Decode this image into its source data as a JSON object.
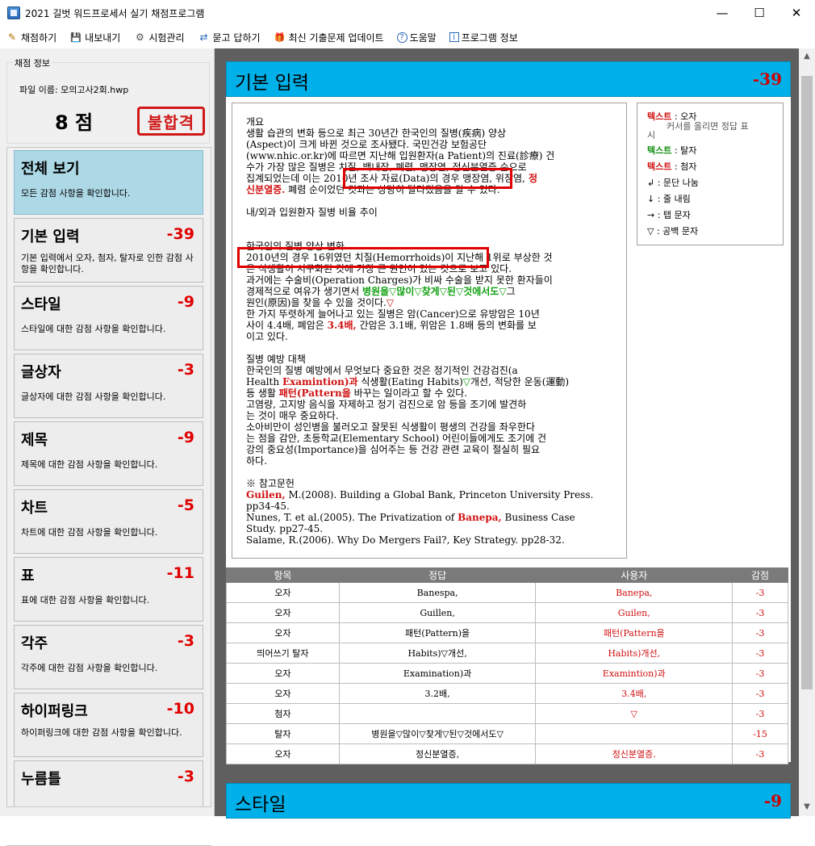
{
  "window": {
    "title": "2021 길벗 워드프로세서 실기 채점프로그램",
    "minimize": "—",
    "maximize": "☐",
    "close": "✕"
  },
  "menu": [
    {
      "icon": "pencil-icon",
      "glyph": "✎",
      "label": "채점하기"
    },
    {
      "icon": "save-icon",
      "glyph": "💾",
      "label": "내보내기"
    },
    {
      "icon": "gear-icon",
      "glyph": "⚙",
      "label": "시험관리"
    },
    {
      "icon": "qa-icon",
      "glyph": "⇄",
      "label": "묻고 답하기"
    },
    {
      "icon": "gift-icon",
      "glyph": "🎁",
      "label": "최신 기출문제 업데이트"
    },
    {
      "icon": "help-icon",
      "glyph": "?",
      "label": "도움말"
    },
    {
      "icon": "info-icon",
      "glyph": "i",
      "label": "프로그램 정보"
    }
  ],
  "score_info": {
    "legend": "채점 정보",
    "file_name": "파일 이름: 모의고사2회.hwp",
    "score": "8 점",
    "result_stamp": "불합격"
  },
  "categories": [
    {
      "title": "전체 보기",
      "score": "",
      "desc": "모든 감점 사항을 확인합니다."
    },
    {
      "title": "기본 입력",
      "score": "-39",
      "desc": "기본 입력에서 오자, 첨자, 탈자로 인한 감점 사항을 확인합니다."
    },
    {
      "title": "스타일",
      "score": "-9",
      "desc": "스타일에 대한 감점 사항을 확인합니다."
    },
    {
      "title": "글상자",
      "score": "-3",
      "desc": "글상자에 대한 감점 사항을 확인합니다."
    },
    {
      "title": "제목",
      "score": "-9",
      "desc": "제목에 대한 감점 사항을 확인합니다."
    },
    {
      "title": "차트",
      "score": "-5",
      "desc": "차트에 대한 감점 사항을 확인합니다."
    },
    {
      "title": "표",
      "score": "-11",
      "desc": "표에 대한 감점 사항을 확인합니다."
    },
    {
      "title": "각주",
      "score": "-3",
      "desc": "각주에 대한 감점 사항을 확인합니다."
    },
    {
      "title": "하이퍼링크",
      "score": "-10",
      "desc": "하이퍼링크에 대한 감점 사항을 확인합니다."
    },
    {
      "title": "누름틀",
      "score": "-3",
      "desc": ""
    }
  ],
  "section1": {
    "title": "기본 입력",
    "score": "-39"
  },
  "section2": {
    "title": "스타일",
    "score": "-9"
  },
  "doc": {
    "l01": "개요",
    "l02": "생활 습관의 변화 등으로 최근 30년간 한국인의 질병(疾病) 양상",
    "l03": "(Aspect)이 크게 바뀐 것으로 조사됐다. 국민건강 보험공단",
    "l04": "(www.nhic.or.kr)에 따르면 지난해 입원환자(a Patient)의 진료(診療) 건",
    "l05": "수가 가장 많은 질병은 치질, 백내장, 폐렴, 맹장염, 정신분열증 순으로",
    "l06": "집계되었는데 이는 2010년 조사 자료(Data)의 경우 맹장염, 위장염,",
    "l06r": " 정",
    "l07r": "신분열증.",
    "l07": " 폐렴 순이었던 것과는 상당히 달라졌음을 알 수 있다.",
    "l08": "내/외과 입원환자 질병 비율 추이",
    "l09": "한국인의 질병 양상 변화",
    "l10": "2010년의 경우 16위였던 치질(Hemorrhoids)이 지난해 1위로 부상한 것",
    "l11": "은 식생활이 서구화된 것에 가장 큰 원인이 있는 것으로 보고 있다.",
    "l12": "과거에는 수술비(Operation Charges)가 비싸 수술을 받지 못한 환자들이",
    "l13a": "경제적으로 여유가 생기면서 ",
    "l13g": "병원을▽많이▽찾게▽된▽것에서도▽",
    "l13b": "그",
    "l14": "원인(原因)을 찾을 수 있을 것이다.",
    "l14r": "▽",
    "l15": "한 가지 뚜렷하게 늘어나고 있는 질병은 암(Cancer)으로 유방암은 10년",
    "l16a": "사이 4.4배, 폐암은 ",
    "l16r": "3.4배,",
    "l16b": " 간암은 3.1배, 위암은 1.8배 등의 변화를 보",
    "l17": "이고 있다.",
    "l18": "질병 예방 대책",
    "l19": "한국인의 질병 예방에서 무엇보다 중요한 것은 정기적인 건강검진(a",
    "l20a": "Health ",
    "l20r": "Examintion)과",
    "l20b": " 식생활(Eating Habits)",
    "l20g": "▽",
    "l20c": "개선, 적당한 운동(運動)",
    "l21a": "등 생활 ",
    "l21r": "패턴(Pattern을",
    "l21b": " 바꾸는 일이라고 할 수 있다.",
    "l22": "고염량, 고지방 음식을 자제하고 정기 검진으로 암 등을 조기에 발견하",
    "l23": "는 것이 매우 중요하다.",
    "l24": "소아비만이 성인병을 불러오고 잘못된 식생활이 평생의 건강을 좌우한다",
    "l25": "는 점을 감안, 초등학교(Elementary School) 어린이들에게도 조기에 건",
    "l26": "강의 중요성(Importance)을 심어주는 등 건강 관련 교육이 절실히 필요",
    "l27": "하다.",
    "l28": "※ 참고문헌",
    "l29r": "Guilen,",
    "l29": " M.(2008). Building a Global Bank, Princeton University Press.",
    "l30": "pp34-45.",
    "l31a": "Nunes, T. et al.(2005). The Privatization of ",
    "l31r": "Banepa,",
    "l31b": " Business Case",
    "l32": "Study. pp27-45.",
    "l33": "Salame, R.(2006). Why Do Mergers Fail?, Key Strategy. pp28-32."
  },
  "legend": {
    "typo_word": "텍스트",
    "typo_label": " : 오자",
    "typo_hint": "커서를 올리면 정답 표",
    "typo_hint2": "시",
    "missing_word": "텍스트",
    "missing_label": " : 탈자",
    "extra_word": "텍스트",
    "extra_label": " : 첨자",
    "para": "↲ : 문단 나눔",
    "line": "↓ : 줄 내림",
    "tab": "→ : 탭 문자",
    "space": "▽ : 공백 문자"
  },
  "table": {
    "headers": [
      "항목",
      "정답",
      "사용자",
      "감점"
    ],
    "rows": [
      [
        "오자",
        "Banespa,",
        "Banepa,",
        "-3"
      ],
      [
        "오자",
        "Guillen,",
        "Guilen,",
        "-3"
      ],
      [
        "오자",
        "패턴(Pattern)을",
        "패턴(Pattern을",
        "-3"
      ],
      [
        "띄어쓰기 탈자",
        "Habits)▽개선,",
        "Habits)개선,",
        "-3"
      ],
      [
        "오자",
        "Examination)과",
        "Examintion)과",
        "-3"
      ],
      [
        "오자",
        "3.2배,",
        "3.4배,",
        "-3"
      ],
      [
        "첨자",
        "",
        "▽",
        "-3"
      ],
      [
        "탈자",
        "병원을▽많이▽찾게▽된▽것에서도▽",
        "",
        "-15"
      ],
      [
        "오자",
        "정신분열증,",
        "정신분열증.",
        "-3"
      ]
    ]
  },
  "colors": {
    "accent_header": "#00b0e8",
    "deduction_red": "#d01010",
    "active_category": "#add8e6"
  }
}
